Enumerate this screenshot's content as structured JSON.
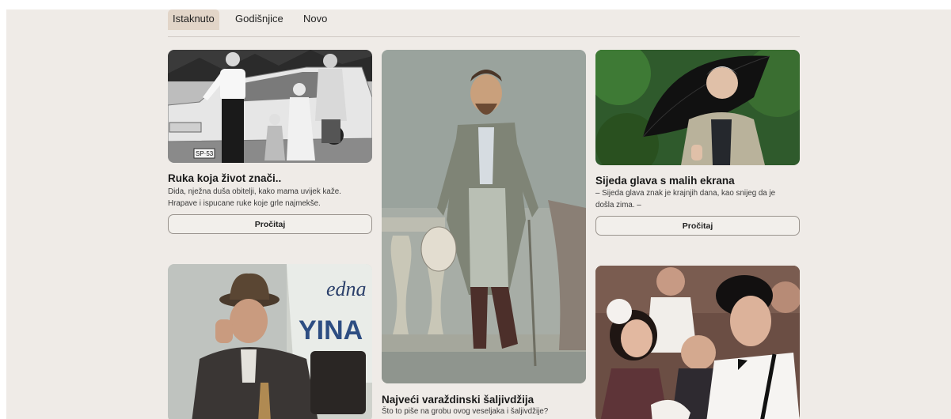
{
  "tabs": [
    {
      "label": "Istaknuto",
      "active": true
    },
    {
      "label": "Godišnjice",
      "active": false
    },
    {
      "label": "Novo",
      "active": false
    }
  ],
  "cards": [
    {
      "title": "Ruka koja život znači..",
      "desc_lines": [
        "Dida, nježna duša obitelji, kako mama uvijek kaže.",
        "Hrapave i ispucane ruke koje grle najmekše."
      ],
      "button": "Pročitaj",
      "plate_text": "SP·53"
    },
    {
      "title": "Najveći varaždinski šaljivdžija",
      "desc_lines": [
        "Što to piše na grobu ovog veseljaka i šaljivdžije?"
      ]
    },
    {
      "title": "Sijeda glava s malih ekrana",
      "desc_lines": [
        "– Sijeda glava znak je krajnjih dana, kao snijeg da je",
        "došla zima. –"
      ],
      "button": "Pročitaj"
    },
    {
      "title": "",
      "sign_text_top": "edna",
      "sign_text_bottom": "YINA"
    },
    {
      "title": ""
    }
  ],
  "colors": {
    "background": "#efebe7",
    "active_tab": "#e2d5c8",
    "button_border": "#9a948e"
  }
}
